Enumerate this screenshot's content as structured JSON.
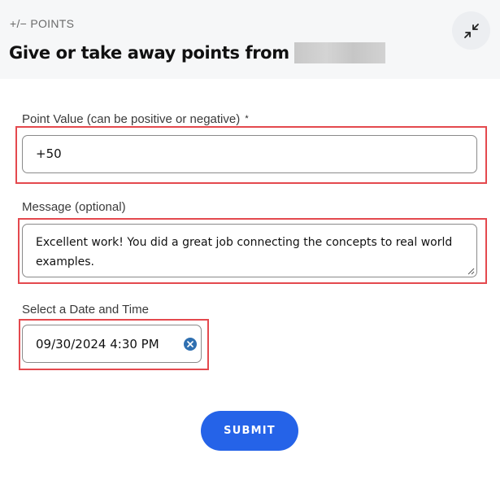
{
  "header": {
    "eyebrow": "+/− POINTS",
    "title": "Give or take away points from"
  },
  "form": {
    "points": {
      "label": "Point Value (can be positive or negative)",
      "required_mark": "*",
      "value": "+50"
    },
    "message": {
      "label": "Message (optional)",
      "value": "Excellent work! You did a great job connecting the concepts to real world examples."
    },
    "datetime": {
      "label": "Select a Date and Time",
      "value": "09/30/2024 4:30 PM"
    },
    "submit_label": "SUBMIT"
  },
  "colors": {
    "accent": "#2563e8",
    "highlight": "#e4494e",
    "header_bg": "#f6f7f8"
  },
  "icons": {
    "collapse": "collapse-arrows-icon",
    "clear": "clear-circle-x-icon",
    "resize": "resize-grip-icon"
  }
}
